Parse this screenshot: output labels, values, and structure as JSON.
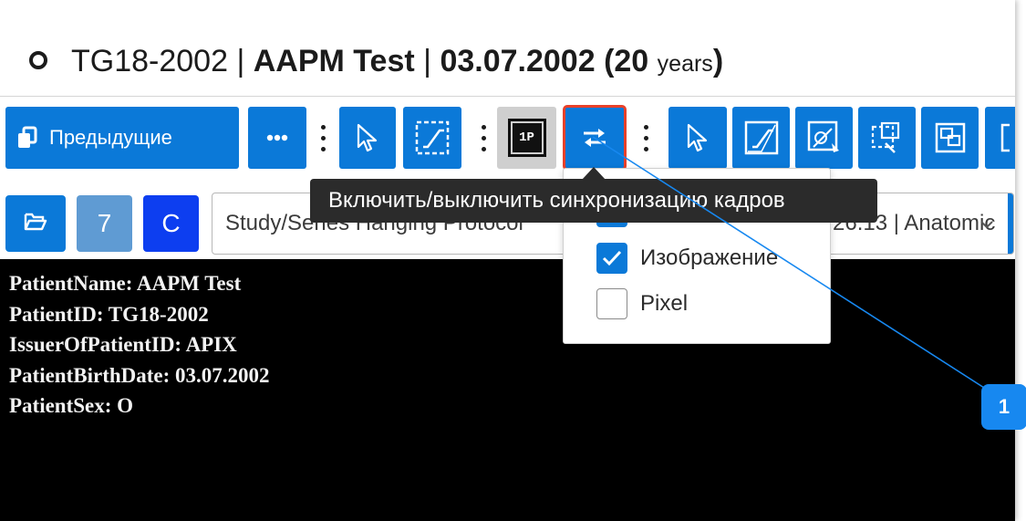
{
  "header": {
    "patient_id": "TG18-2002",
    "separator": "|",
    "patient_name": "AAPM Test",
    "birth_date": "03.07.2002",
    "age_value": "(20",
    "age_unit": "years",
    "age_close": ")"
  },
  "toolbar": {
    "previous_label": "Предыдущие",
    "more_icon": "ellipsis-icon",
    "layout_label": "1P",
    "sync_active": true
  },
  "tooltip": {
    "text": "Включить/выключить синхронизацию кадров"
  },
  "sync_menu": {
    "items": [
      {
        "label": "Изображение",
        "checked": true
      },
      {
        "label": "Pixel",
        "checked": false
      }
    ]
  },
  "row2": {
    "series_count": "7",
    "c_label": "C",
    "protocol_select_value": "Study/Series Hanging Protocol",
    "protocol_select_tail": "26.13 | Anatomic"
  },
  "viewer": {
    "overlay": [
      "PatientName: AAPM Test",
      "PatientID: TG18-2002",
      "IssuerOfPatientID: APIX",
      "PatientBirthDate: 03.07.2002",
      "PatientSex: O"
    ]
  },
  "callout": {
    "number": "1",
    "color": "#1788f0"
  },
  "colors": {
    "primary": "#0b79d8",
    "highlight_border": "#e8412a",
    "c_button": "#0d3ef0",
    "count_button": "#5f9bd3"
  }
}
